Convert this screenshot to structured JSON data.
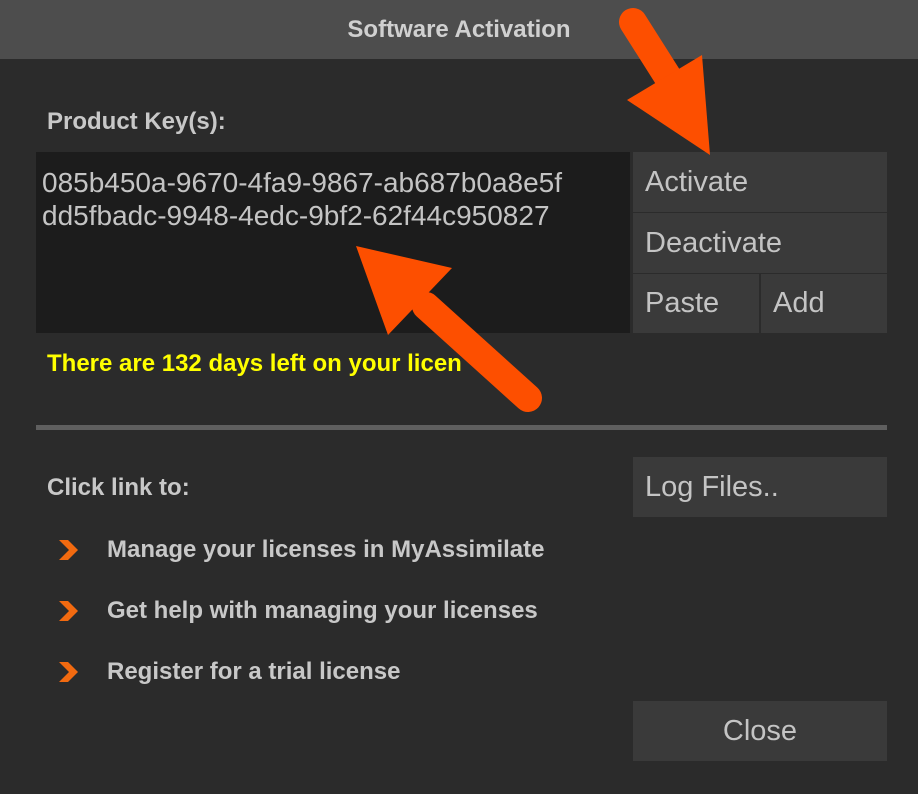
{
  "window": {
    "title": "Software Activation"
  },
  "product_keys": {
    "label": "Product Key(s):",
    "keys": [
      "085b450a-9670-4fa9-9867-ab687b0a8e5f",
      "dd5fbadc-9948-4edc-9bf2-62f44c950827"
    ]
  },
  "buttons": {
    "activate": "Activate",
    "deactivate": "Deactivate",
    "paste": "Paste",
    "add": "Add",
    "log_files": "Log Files..",
    "close": "Close"
  },
  "license_message": "There are 132 days left on your licen",
  "links": {
    "label": "Click link to:",
    "items": [
      "Manage your licenses in MyAssimilate",
      "Get help with managing your licenses",
      "Register for a trial license"
    ]
  },
  "colors": {
    "background": "#2b2b2b",
    "titlebar": "#4d4d4d",
    "message": "#ffff00",
    "chevron": "#f26a10",
    "annotation_arrow": "#fd4f00"
  },
  "annotations": {
    "arrows": [
      {
        "icon": "arrow-pointing-to-activate"
      },
      {
        "icon": "arrow-pointing-to-product-keys"
      }
    ]
  }
}
